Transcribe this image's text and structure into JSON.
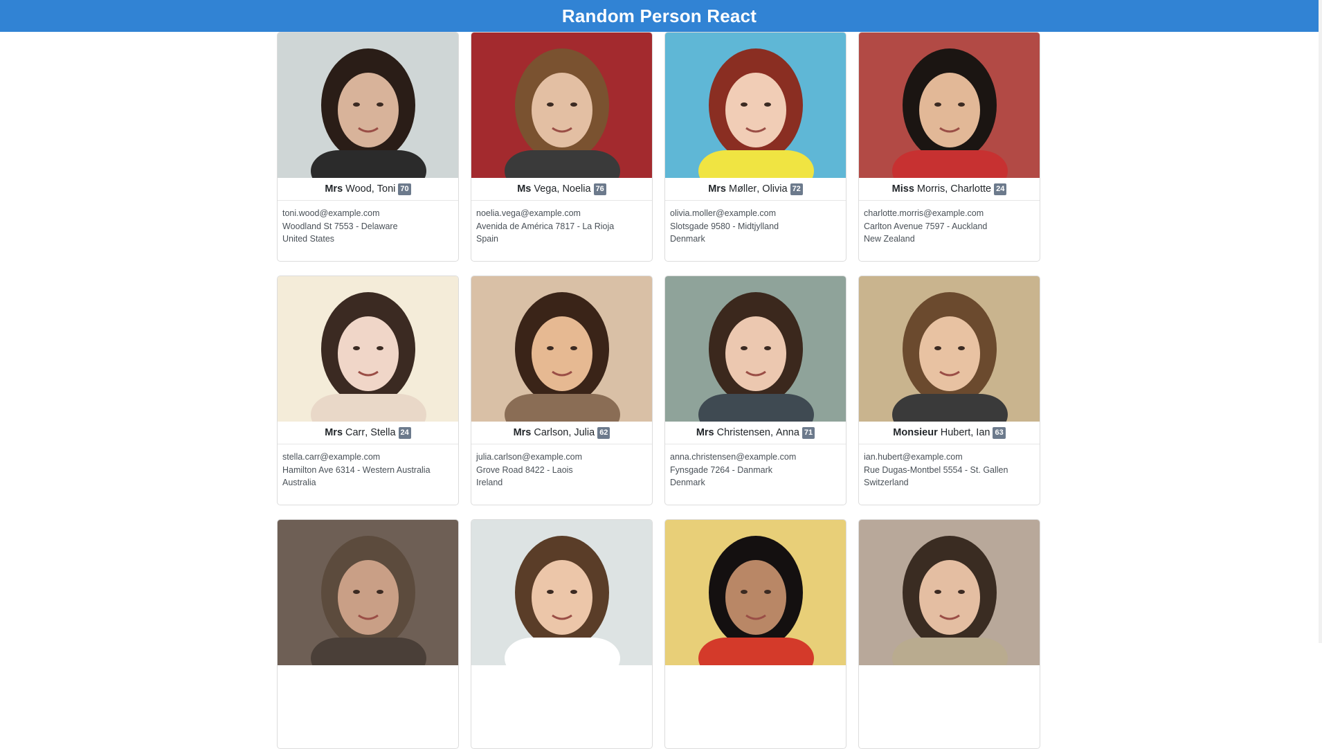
{
  "header": {
    "title": "Random Person React"
  },
  "people": [
    {
      "title": "Mrs",
      "last": "Wood",
      "first": "Toni",
      "age": "70",
      "email": "toni.wood@example.com",
      "address": "Woodland St 7553 - Delaware",
      "country": "United States",
      "bg": "#cfd6d6",
      "hair": "#2a1d17",
      "skin": "#d8b39a",
      "shirt": "#2b2b2b"
    },
    {
      "title": "Ms",
      "last": "Vega",
      "first": "Noelia",
      "age": "76",
      "email": "noelia.vega@example.com",
      "address": "Avenida de América 7817 - La Rioja",
      "country": "Spain",
      "bg": "#a32a2e",
      "hair": "#7a5230",
      "skin": "#e3bfa3",
      "shirt": "#3a3a3a"
    },
    {
      "title": "Mrs",
      "last": "Møller",
      "first": "Olivia",
      "age": "72",
      "email": "olivia.moller@example.com",
      "address": "Slotsgade 9580 - Midtjylland",
      "country": "Denmark",
      "bg": "#5fb7d6",
      "hair": "#8a2e22",
      "skin": "#f1cdb6",
      "shirt": "#f0e442"
    },
    {
      "title": "Miss",
      "last": "Morris",
      "first": "Charlotte",
      "age": "24",
      "email": "charlotte.morris@example.com",
      "address": "Carlton Avenue 7597 - Auckland",
      "country": "New Zealand",
      "bg": "#b24a45",
      "hair": "#1b1512",
      "skin": "#e2b897",
      "shirt": "#c73131"
    },
    {
      "title": "Mrs",
      "last": "Carr",
      "first": "Stella",
      "age": "24",
      "email": "stella.carr@example.com",
      "address": "Hamilton Ave 6314 - Western Australia",
      "country": "Australia",
      "bg": "#f4ecd9",
      "hair": "#3b2a22",
      "skin": "#f0d6c8",
      "shirt": "#e9d8c8"
    },
    {
      "title": "Mrs",
      "last": "Carlson",
      "first": "Julia",
      "age": "62",
      "email": "julia.carlson@example.com",
      "address": "Grove Road 8422 - Laois",
      "country": "Ireland",
      "bg": "#d9c0a6",
      "hair": "#3a2418",
      "skin": "#e6b992",
      "shirt": "#8a6d55"
    },
    {
      "title": "Mrs",
      "last": "Christensen",
      "first": "Anna",
      "age": "71",
      "email": "anna.christensen@example.com",
      "address": "Fynsgade 7264 - Danmark",
      "country": "Denmark",
      "bg": "#8fa39a",
      "hair": "#3b281d",
      "skin": "#ecc8b0",
      "shirt": "#3f4a52"
    },
    {
      "title": "Monsieur",
      "last": "Hubert",
      "first": "Ian",
      "age": "63",
      "email": "ian.hubert@example.com",
      "address": "Rue Dugas-Montbel 5554 - St. Gallen",
      "country": "Switzerland",
      "bg": "#c9b48e",
      "hair": "#6b4a2e",
      "skin": "#e8c2a2",
      "shirt": "#3a3a3a"
    },
    {
      "title": "",
      "last": "",
      "first": "",
      "age": "",
      "email": "",
      "address": "",
      "country": "",
      "bg": "#6e5f55",
      "hair": "#5c4b3d",
      "skin": "#c99f86",
      "shirt": "#4a3f38"
    },
    {
      "title": "",
      "last": "",
      "first": "",
      "age": "",
      "email": "",
      "address": "",
      "country": "",
      "bg": "#dde3e3",
      "hair": "#5a3d28",
      "skin": "#ecc6a9",
      "shirt": "#ffffff"
    },
    {
      "title": "",
      "last": "",
      "first": "",
      "age": "",
      "email": "",
      "address": "",
      "country": "",
      "bg": "#e8cf78",
      "hair": "#141010",
      "skin": "#b98766",
      "shirt": "#d43a2a"
    },
    {
      "title": "",
      "last": "",
      "first": "",
      "age": "",
      "email": "",
      "address": "",
      "country": "",
      "bg": "#b8a89a",
      "hair": "#3a2c22",
      "skin": "#e4bea2",
      "shirt": "#b9ab8f"
    }
  ]
}
